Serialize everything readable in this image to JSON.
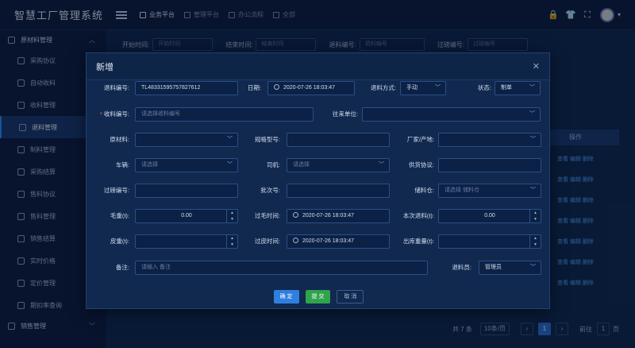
{
  "app": {
    "title": "智慧工厂管理系统"
  },
  "topnav": [
    {
      "label": "业务平台",
      "active": true
    },
    {
      "label": "管理平台",
      "active": false
    },
    {
      "label": "办公流程",
      "active": false
    },
    {
      "label": "全部",
      "active": false
    }
  ],
  "sidebar": {
    "group1": "原材料管理",
    "items": [
      "采购协议",
      "自动收料",
      "收料管理",
      "退料管理",
      "制料管理",
      "采购结算",
      "售料协议",
      "售料管理",
      "销售结算",
      "实时价格",
      "定价管理",
      "期扣率查询"
    ],
    "group2": "销售管理"
  },
  "filter": {
    "start_label": "开始时间:",
    "start_ph": "开始时间",
    "end_label": "结束时间:",
    "end_ph": "结束时间",
    "ret_label": "退料编号:",
    "ret_ph": "退料编号",
    "weigh_label": "过磅编号:",
    "weigh_ph": "过磅编号"
  },
  "grid": {
    "op_header": "操作",
    "row_links": "查看 编辑 删除"
  },
  "pager": {
    "total": "共 7 条",
    "size": "10条/页",
    "page": "1",
    "goto": "前往",
    "goto_val": "1",
    "goto_unit": "页"
  },
  "modal": {
    "title": "新增",
    "ret_no_label": "退料编号:",
    "ret_no": "TL48331595757827612",
    "date_label": "日期:",
    "date": "2020-07-26 18:03:47",
    "method_label": "退料方式:",
    "method": "手动",
    "status_label": "状态:",
    "status": "制单",
    "recv_no_label": "收料编号:",
    "recv_no_ph": "请选择收料编号",
    "partner_label": "往来单位:",
    "material_label": "原材料:",
    "spec_label": "规格型号:",
    "vendor_label": "厂家/产地:",
    "vehicle_label": "车辆:",
    "vehicle_ph": "请选择",
    "driver_label": "司机:",
    "driver_ph": "请选择",
    "supply_label": "供货协议:",
    "weigh_label": "过磅编号:",
    "batch_label": "批次号:",
    "warehouse_label": "储料仓:",
    "warehouse_ph": "请选择 储料仓",
    "gross_label": "毛重(t):",
    "gross": "0.00",
    "gross_time_label": "过毛时间:",
    "gross_time": "2020-07-26 18:03:47",
    "this_ret_label": "本次退料(t):",
    "this_ret": "0.00",
    "tare_label": "皮重(t):",
    "tare_time_label": "过皮时间:",
    "tare_time": "2020-07-26 18:03:47",
    "out_weight_label": "出库重量(t):",
    "remark_label": "备注:",
    "remark_ph": "请输入 备注",
    "operator_label": "退料员:",
    "operator": "管理员",
    "confirm": "确 定",
    "submit": "提 交",
    "cancel": "取 消"
  }
}
